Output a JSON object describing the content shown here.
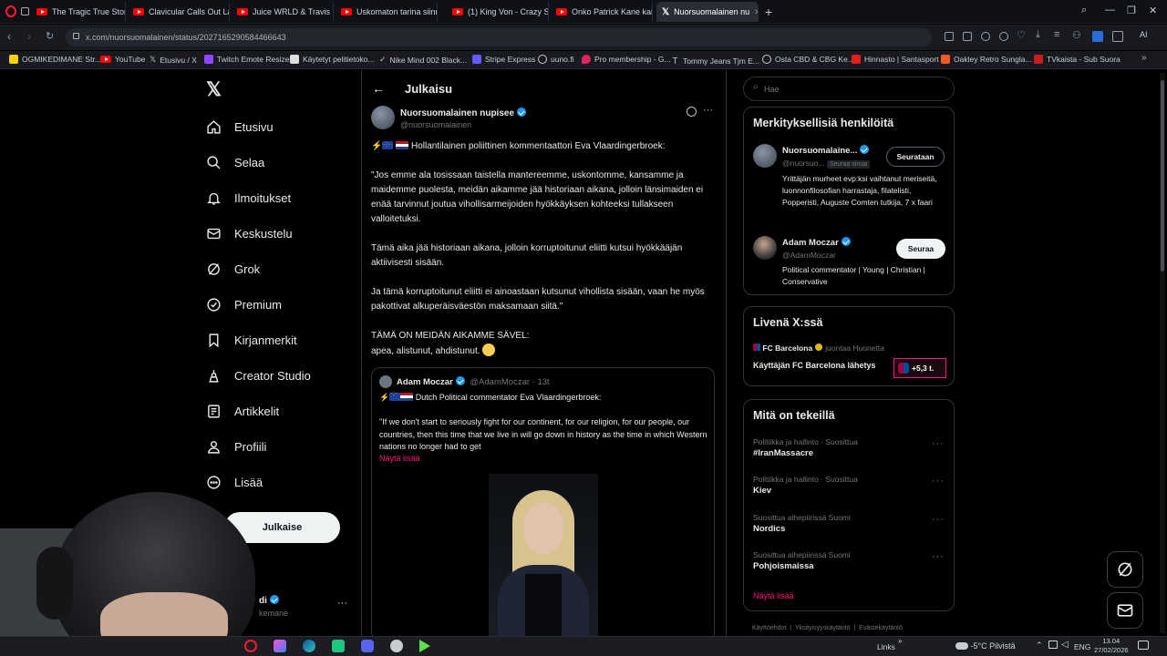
{
  "browser": {
    "tabs": [
      {
        "title": "The Tragic True Story of Ju",
        "icon": "youtube-icon"
      },
      {
        "title": "Clavicular Calls Out Larry",
        "icon": "youtube-icon"
      },
      {
        "title": "Juice WRLD & Travis Scott",
        "icon": "youtube-icon"
      },
      {
        "title": "Uskomaton tarina siinnikk",
        "icon": "youtube-icon"
      },
      {
        "title": "(1) King Von - Crazy Story",
        "icon": "youtube-icon"
      },
      {
        "title": "Onko Patrick Kane kaikkie",
        "icon": "youtube-icon"
      },
      {
        "title": "Nuorsuomalainen nu",
        "icon": "x-icon"
      }
    ],
    "url": "x.com/nuorsuomalainen/status/2027165290584466643",
    "bookmarks": [
      "OGMIKEDIMANE Str...",
      "YouTube",
      "Etusivu / X",
      "Twitch Emote Resizer",
      "Käytetyt pelitietoko...",
      "Nike Mind 002 Black...",
      "Stripe Express",
      "uuno.fi",
      "Pro membership - G...",
      "Tommy Jeans Tjm E...",
      "Osta CBD & CBG Ke...",
      "Hinnasto | Santasport",
      "Oakley Retro Sungla...",
      "TVkaista - Sub Suora"
    ]
  },
  "nav": {
    "items": [
      "Etusivu",
      "Selaa",
      "Ilmoitukset",
      "Keskustelu",
      "Grok",
      "Premium",
      "Kirjanmerkit",
      "Creator Studio",
      "Artikkelit",
      "Profiili",
      "Lisää"
    ],
    "post_button": "Julkaise",
    "account_name_partial": "di",
    "account_handle_partial": "kemane"
  },
  "header": {
    "title": "Julkaisu"
  },
  "tweet": {
    "author": "Nuorsuomalainen nupisee",
    "handle": "@nuorsuomalainen",
    "intro": "Hollantilainen poliittinen kommentaattori Eva Vlaardingerbroek:",
    "p1": "\"Jos emme ala tosissaan taistella mantereemme, uskontomme, kansamme ja maidemme puolesta, meidän aikamme jää historiaan aikana, jolloin länsimaiden ei enää tarvinnut joutua vihollisarmeijoiden hyökkäyksen kohteeksi tullakseen valloitetuksi.",
    "p2": "Tämä aika jää historiaan aikana, jolloin korruptoitunut eliitti kutsui hyökkääjän aktiivisesti sisään.",
    "p3": "Ja tämä korruptoitunut eliitti ei ainoastaan kutsunut vihollista sisään, vaan he myös pakottivat alkuperäisväestön maksamaan siitä.\"",
    "p4a": "TÄMÄ ON MEIDÄN AIKAMME SÄVEL:",
    "p4b": "apea, alistunut, ahdistunut."
  },
  "quote": {
    "author": "Adam Moczar",
    "handle": "@AdamMoczar",
    "time": "· 13t",
    "intro": "Dutch Political commentator Eva Vlaardingerbroek:",
    "text": "\"If we don't start to seriously fight for our continent, for our religion, for our people, our countries, then this time that we live in will go down in history as the time in which Western nations no longer had to get",
    "show_more": "Näytä lisää"
  },
  "right": {
    "search_placeholder": "Hae",
    "people_title": "Merkityksellisiä henkilöitä",
    "person1": {
      "name": "Nuorsuomalaine...",
      "handle": "@nuorsuo...",
      "badge": "Seuraa sinua",
      "button": "Seurataan",
      "bio": "Yrittäjän murheet evp:ksi vaihtanut meriseitä, luonnonfilosofian harrastaja, filatelisti, Popperisti, Auguste Comten tutkija, 7 x faari"
    },
    "person2": {
      "name": "Adam Moczar",
      "handle": "@AdamMoczar",
      "button": "Seuraa",
      "bio": "Political commentator | Young | Christian | Conservative"
    },
    "live_title": "Livenä X:ssä",
    "live": {
      "host": "FC Barcelona",
      "tag": "juontaa Huonetta",
      "title": "Käyttäjän FC Barcelona lähetys",
      "count": "+5,3 t."
    },
    "trends_title": "Mitä on tekeillä",
    "trends": [
      {
        "meta": "Politiikka ja hallinto · Suosittua",
        "title": "#IranMassacre"
      },
      {
        "meta": "Politiikka ja hallinto · Suosittua",
        "title": "Kiev"
      },
      {
        "meta": "Suosittua aihepiirissä Suomi",
        "title": "Nordics"
      },
      {
        "meta": "Suosittua aihepiirissä Suomi",
        "title": "Pohjoismaissa"
      }
    ],
    "show_more": "Näytä lisää",
    "footer": [
      "Käyttöehdot",
      "Yksityisyyskäytäntö",
      "Evästekäytäntö"
    ]
  },
  "taskbar": {
    "links": "Links",
    "weather": "-5°C  Pilvistä",
    "lang": "ENG",
    "time": "13.04",
    "date": "27/02/2026"
  },
  "colors": {
    "accent": "#1d9bf0",
    "show_more": "#f91880",
    "bg": "#000000"
  }
}
